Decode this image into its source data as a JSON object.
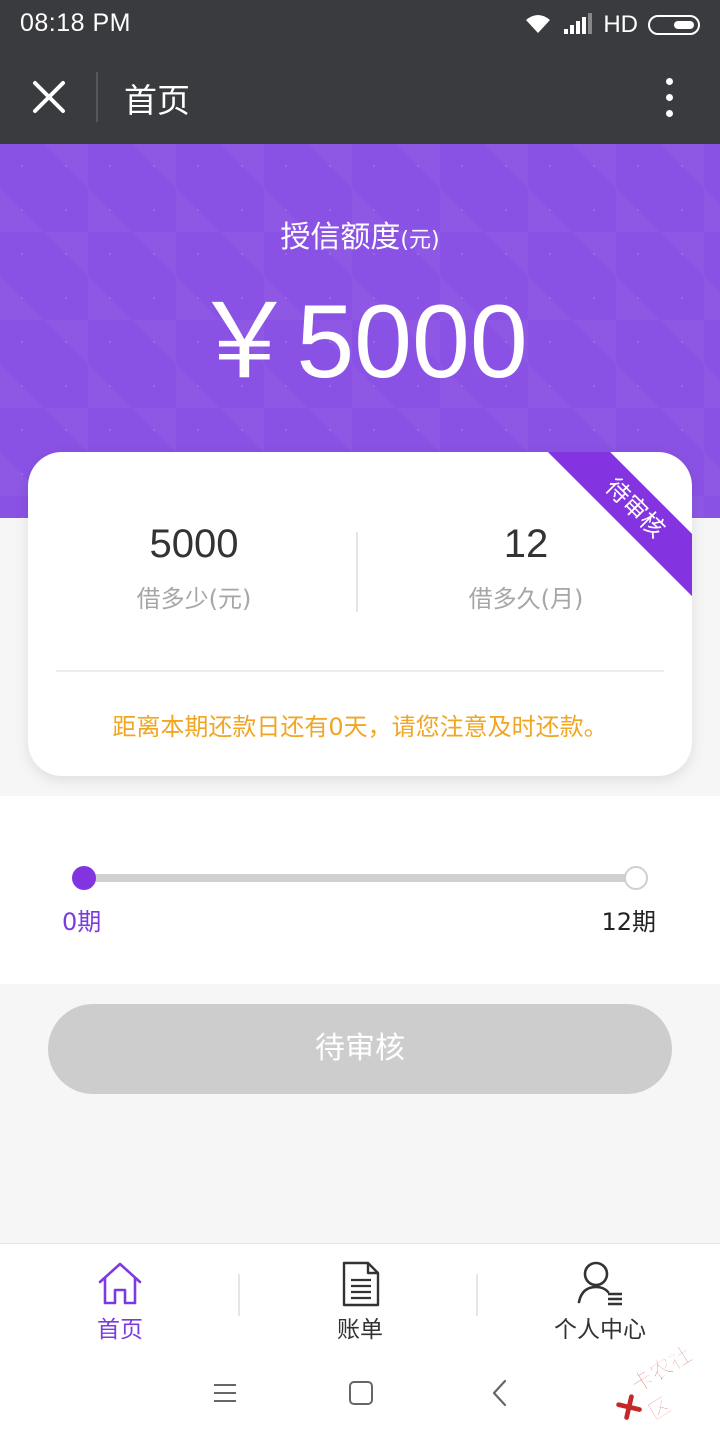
{
  "status_bar": {
    "time": "08:18  PM",
    "network": "HD"
  },
  "header": {
    "title": "首页"
  },
  "hero": {
    "credit_label": "授信额度",
    "credit_unit": "(元)",
    "credit_amount": "￥5000"
  },
  "loan_card": {
    "ribbon": "待审核",
    "amount_value": "5000",
    "amount_label": "借多少(元)",
    "term_value": "12",
    "term_label": "借多久(月)",
    "notice": "距离本期还款日还有0天，请您注意及时还款。"
  },
  "progress": {
    "start_label": "0期",
    "end_label": "12期",
    "current": 0,
    "total": 12
  },
  "action_button": {
    "label": "待审核"
  },
  "tabs": [
    {
      "label": "首页",
      "icon": "home-icon",
      "active": true
    },
    {
      "label": "账单",
      "icon": "bill-icon",
      "active": false
    },
    {
      "label": "个人中心",
      "icon": "user-center-icon",
      "active": false
    }
  ],
  "watermark": {
    "text": "卡农社区"
  },
  "colors": {
    "primary": "#8a52e4",
    "accent": "#7c3be0",
    "notice": "#f0a623",
    "disabled": "#cdcdcd",
    "bar": "#3a3b3f"
  }
}
